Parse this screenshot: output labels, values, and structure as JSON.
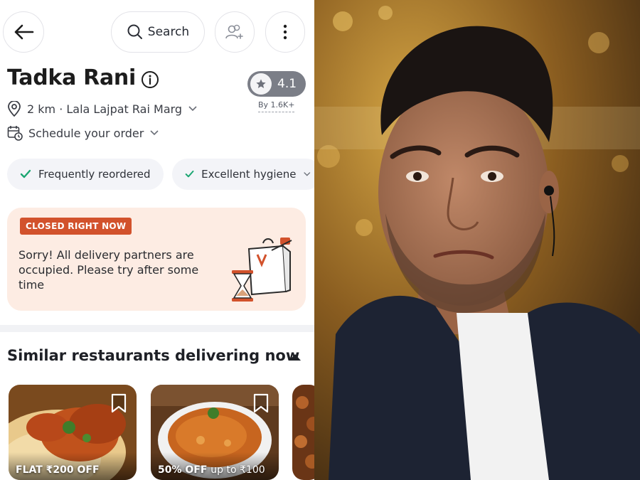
{
  "header": {
    "search_label": "Search"
  },
  "restaurant": {
    "name": "Tadka Rani",
    "rating": "4.1",
    "rating_count": "By 1.6K+",
    "location": "2 km · Lala Lajpat Rai Marg",
    "schedule": "Schedule your order"
  },
  "tags": [
    {
      "label": "Frequently reordered"
    },
    {
      "label": "Excellent hygiene"
    }
  ],
  "closed_notice": {
    "badge": "CLOSED RIGHT NOW",
    "message": "Sorry! All delivery partners are occupied. Please try after some time"
  },
  "similar": {
    "title": "Similar restaurants delivering now",
    "cards": [
      {
        "offer_main": "FLAT ₹200 OFF",
        "offer_sub": ""
      },
      {
        "offer_main": "50% OFF",
        "offer_sub": "up to ₹100"
      }
    ]
  },
  "icons": {
    "back": "back-arrow-icon",
    "search": "search-icon",
    "group_order": "add-group-icon",
    "more": "more-vertical-icon",
    "info": "info-icon",
    "star": "star-icon",
    "location": "location-pin-icon",
    "schedule": "calendar-clock-icon",
    "check": "check-icon",
    "bookmark": "bookmark-icon"
  },
  "colors": {
    "accent_red": "#d2522c",
    "check_green": "#1ba672",
    "rating_pill": "#7b7e87",
    "closed_card_bg": "#fdece3"
  }
}
